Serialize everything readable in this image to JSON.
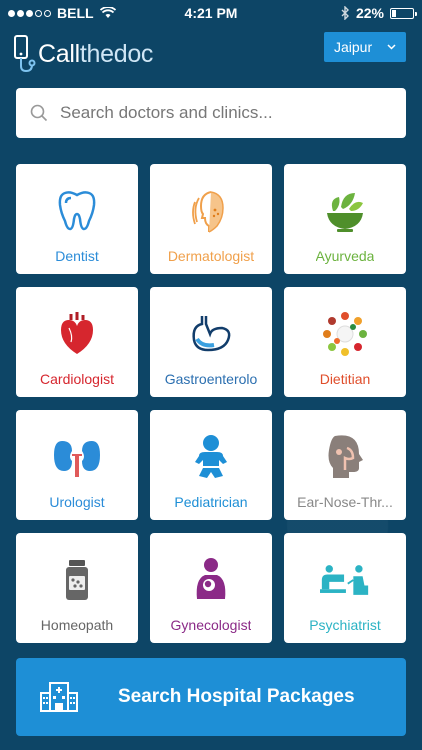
{
  "status_bar": {
    "carrier": "BELL",
    "time": "4:21 PM",
    "battery": "22%",
    "battery_level": 0.22
  },
  "header": {
    "logo_bold": "Call",
    "logo_thin": "thedoc",
    "city": "Jaipur"
  },
  "search": {
    "placeholder": "Search doctors and clinics..."
  },
  "specialties": [
    {
      "label": "Dentist",
      "color": "#2b8cd8",
      "icon": "tooth-icon"
    },
    {
      "label": "Dermatologist",
      "color": "#f0a04b",
      "icon": "face-icon"
    },
    {
      "label": "Ayurveda",
      "color": "#6cb33f",
      "icon": "mortar-leaf-icon"
    },
    {
      "label": "Cardiologist",
      "color": "#d6262e",
      "icon": "heart-icon"
    },
    {
      "label": "Gastroenterolo",
      "color": "#2b6fb0",
      "icon": "stomach-icon"
    },
    {
      "label": "Dietitian",
      "color": "#e04e2b",
      "icon": "food-plate-icon"
    },
    {
      "label": "Urologist",
      "color": "#2b8cd8",
      "icon": "kidney-icon"
    },
    {
      "label": "Pediatrician",
      "color": "#1e8fd6",
      "icon": "baby-icon"
    },
    {
      "label": "Ear-Nose-Thr...",
      "color": "#888888",
      "icon": "ent-head-icon"
    },
    {
      "label": "Homeopath",
      "color": "#666666",
      "icon": "medicine-bottle-icon"
    },
    {
      "label": "Gynecologist",
      "color": "#8b2a87",
      "icon": "mother-baby-icon"
    },
    {
      "label": "Psychiatrist",
      "color": "#2bb3c4",
      "icon": "therapy-couch-icon"
    }
  ],
  "packages": {
    "label": "Search Hospital Packages",
    "icon": "hospital-icon"
  }
}
